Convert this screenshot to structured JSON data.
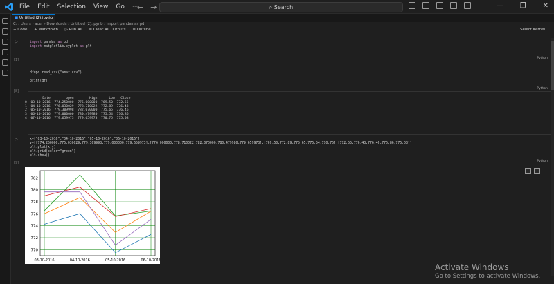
{
  "menu": [
    "File",
    "Edit",
    "Selection",
    "View",
    "Go",
    "···"
  ],
  "search": {
    "label": "Search"
  },
  "tab": {
    "title": "Untitled (2).ipynb"
  },
  "breadcrumb": "C: › Users › acer › Downloads › Untitled (2).ipynb › import pandas as pd",
  "toolbar": {
    "code": "+ Code",
    "markdown": "+ Markdown",
    "run_all": "▷ Run All",
    "clear": "≡ Clear All Outputs",
    "outline": "≡ Outline",
    "select_kernel": "Select Kernel"
  },
  "cells": [
    {
      "num": "[1]",
      "lang": "Python"
    },
    {
      "num": "[8]",
      "lang": "Python"
    },
    {
      "num": "[9]",
      "lang": "Python"
    }
  ],
  "code1": {
    "line1_kw": "import",
    "line1_mod": "pandas",
    "line1_as": "as",
    "line1_alias": "pd",
    "line2_kw": "import",
    "line2_mod": "matplotlib.pyplot",
    "line2_as": "as",
    "line2_alias": "plt"
  },
  "code2": {
    "line1": "df=pd.read_csv(\"amaz.csv\")",
    "line2": "print(df)"
  },
  "df_output": {
    "header": "         Date        open        High      Low   Close",
    "rows": [
      "0  03-10-2016  774.250000  776.000000  769.50  772.55",
      "1  04-10-2016  776.030029  778.710022  772.89  776.43",
      "2  05-10-2016  779.309998  782.070000  775.65  776.46",
      "3  06-10-2016  779.000000  780.479980  775.54  776.86",
      "4  07-10-2016  779.659973  779.659973  770.75  775.08"
    ]
  },
  "code3": {
    "line1": "x=[\"03-10-2016\",\"04-10-2016\",\"05-10-2016\",\"06-10-2016\"]",
    "line2": "y=[[774.250000,776.030029,779.309998,779.000000,779.659973],[776.000000,778.710022,782.070000,780.479980,779.659973],[769.50,772.89,775.65,775.54,770.75],[772.55,776.43,776.46,776.86,775.08]]",
    "line3": "plt.plot(x,y)",
    "line4": "plt.grid(color=\"green\")",
    "line5": "plt.show()"
  },
  "chart_data": {
    "type": "line",
    "categories": [
      "03-10-2016",
      "04-10-2016",
      "05-10-2016",
      "06-10-2016"
    ],
    "series": [
      {
        "color": "#1f77b4",
        "values": [
          774.25,
          776.03,
          769.5,
          772.55
        ]
      },
      {
        "color": "#ff7f0e",
        "values": [
          776.0,
          778.71,
          772.89,
          776.43
        ]
      },
      {
        "color": "#2ca02c",
        "values": [
          776.5,
          782.5,
          775.65,
          776.46
        ]
      },
      {
        "color": "#d62728",
        "values": [
          779.0,
          780.48,
          775.54,
          776.86
        ]
      },
      {
        "color": "#9467bd",
        "values": [
          779.66,
          779.66,
          770.75,
          775.08
        ]
      }
    ],
    "y_ticks": [
      770,
      772,
      774,
      776,
      778,
      780,
      782
    ],
    "ylim": [
      769.0,
      783.2
    ],
    "grid": true,
    "grid_color": "#008000"
  },
  "watermark": {
    "title": "Activate Windows",
    "subtitle": "Go to Settings to activate Windows."
  }
}
